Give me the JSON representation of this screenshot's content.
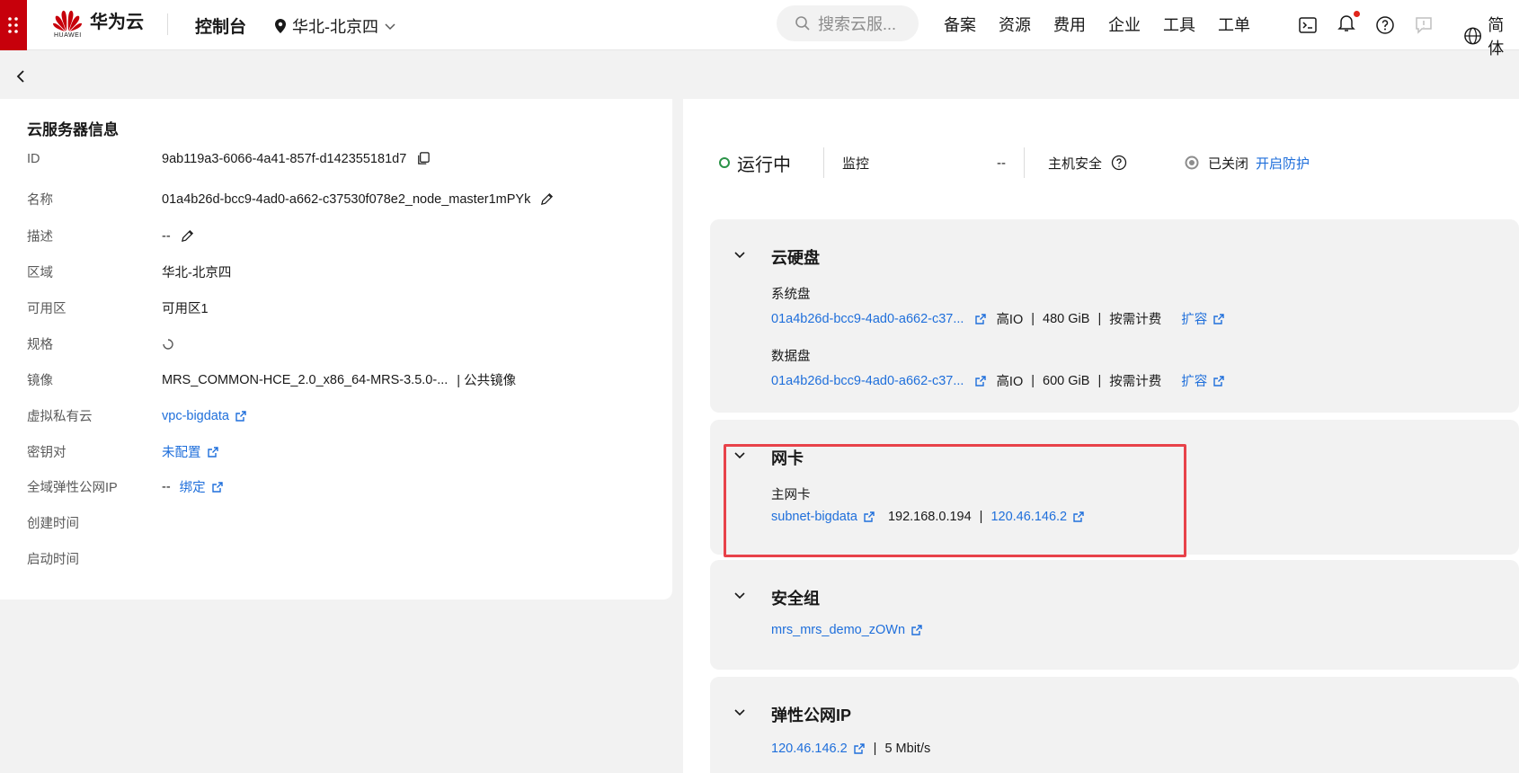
{
  "header": {
    "brand": "华为云",
    "brand_sub": "HUAWEI",
    "console": "控制台",
    "region": "华北-北京四",
    "search_placeholder": "搜索云服...",
    "nav": [
      "备案",
      "资源",
      "费用",
      "企业",
      "工具",
      "工单"
    ],
    "lang": "简体"
  },
  "server_info": {
    "title": "云服务器信息",
    "rows": [
      {
        "label": "ID",
        "value": "9ab119a3-6066-4a41-857f-d142355181d7"
      },
      {
        "label": "名称",
        "value": "01a4b26d-bcc9-4ad0-a662-c37530f078e2_node_master1mPYk"
      },
      {
        "label": "描述",
        "value": "--"
      },
      {
        "label": "区域",
        "value": "华北-北京四"
      },
      {
        "label": "可用区",
        "value": "可用区1"
      },
      {
        "label": "规格",
        "value": ""
      },
      {
        "label": "镜像",
        "value": "MRS_COMMON-HCE_2.0_x86_64-MRS-3.5.0-...",
        "extra": "| 公共镜像"
      },
      {
        "label": "虚拟私有云",
        "value": "vpc-bigdata"
      },
      {
        "label": "密钥对",
        "value": "未配置"
      },
      {
        "label": "全域弹性公网IP",
        "value": "--",
        "link": "绑定"
      },
      {
        "label": "创建时间",
        "value": ""
      },
      {
        "label": "启动时间",
        "value": ""
      }
    ]
  },
  "status": {
    "running": "运行中",
    "monitor_label": "监控",
    "monitor_value": "--",
    "security_label": "主机安全",
    "security_state": "已关闭",
    "security_action": "开启防护"
  },
  "disks": {
    "title": "云硬盘",
    "system_label": "系统盘",
    "system_name": "01a4b26d-bcc9-4ad0-a662-c37...",
    "system_type": "高IO",
    "system_size": "480 GiB",
    "system_billing": "按需计费",
    "system_action": "扩容",
    "data_label": "数据盘",
    "data_name": "01a4b26d-bcc9-4ad0-a662-c37...",
    "data_type": "高IO",
    "data_size": "600 GiB",
    "data_billing": "按需计费",
    "data_action": "扩容"
  },
  "nic": {
    "title": "网卡",
    "main_label": "主网卡",
    "subnet": "subnet-bigdata",
    "private_ip": "192.168.0.194",
    "public_ip": "120.46.146.2"
  },
  "security_group": {
    "title": "安全组",
    "name": "mrs_mrs_demo_zOWn"
  },
  "eip": {
    "title": "弹性公网IP",
    "address": "120.46.146.2",
    "bandwidth": "5 Mbit/s"
  },
  "colors": {
    "brand_red": "#c7000b",
    "link": "#1f6fdb",
    "highlight": "#e8424a",
    "running": "#2b9348"
  }
}
